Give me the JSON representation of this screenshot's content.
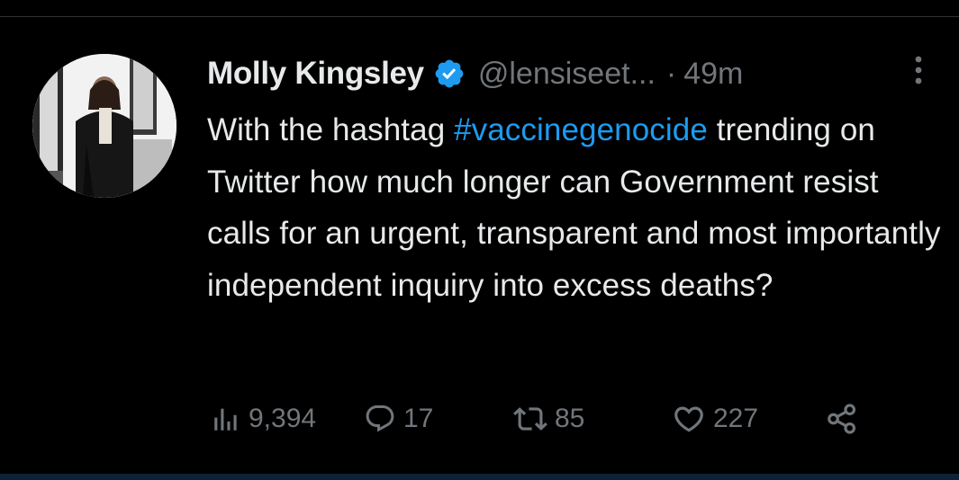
{
  "tweet": {
    "author_name": "Molly Kingsley",
    "handle": "@lensiseet...",
    "separator": "·",
    "time": "49m",
    "text_before": "With the hashtag ",
    "hashtag": "#vaccinegenocide",
    "text_after": " trending on Twitter how much longer can Government resist calls for an urgent, transparent and most importantly independent inquiry into excess deaths?"
  },
  "actions": {
    "views": "9,394",
    "replies": "17",
    "retweets": "85",
    "likes": "227"
  },
  "colors": {
    "background": "#000000",
    "text": "#e7e9ea",
    "muted": "#71767b",
    "link": "#1d9bf0",
    "verified": "#1d9bf0"
  },
  "icons": [
    "verified-badge-icon",
    "more-options-icon",
    "views-icon",
    "reply-icon",
    "retweet-icon",
    "like-icon",
    "share-icon"
  ]
}
